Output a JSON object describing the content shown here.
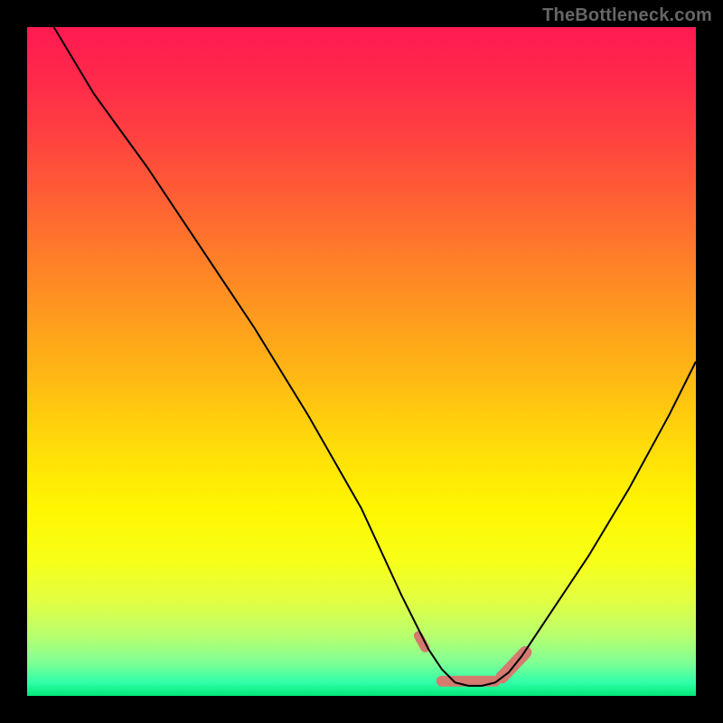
{
  "watermark": "TheBottleneck.com",
  "chart_data": {
    "type": "line",
    "title": "",
    "xlabel": "",
    "ylabel": "",
    "xlim": [
      0,
      100
    ],
    "ylim": [
      0,
      100
    ],
    "series": [
      {
        "name": "bottleneck-curve",
        "x": [
          4,
          10,
          18,
          26,
          34,
          42,
          50,
          56,
          60,
          62,
          64,
          66,
          68,
          70,
          72,
          74,
          78,
          84,
          90,
          96,
          100
        ],
        "y": [
          100,
          90,
          79,
          67,
          55,
          42,
          28,
          15,
          7,
          4,
          2,
          1.5,
          1.5,
          2,
          3.5,
          6,
          12,
          21,
          31,
          42,
          50
        ],
        "stroke": "#000000",
        "stroke_width": 2
      }
    ],
    "highlight": {
      "name": "optimal-band",
      "color": "#d47a6f",
      "segments": [
        {
          "x1": 58.5,
          "y1": 9.0,
          "x2": 59.5,
          "y2": 7.2,
          "w": 10
        },
        {
          "x1": 62.0,
          "y1": 2.2,
          "x2": 70.0,
          "y2": 2.2,
          "w": 12
        },
        {
          "x1": 71.0,
          "y1": 2.8,
          "x2": 74.5,
          "y2": 6.5,
          "w": 14
        }
      ]
    },
    "background_gradient": {
      "top_color": "#ff1a52",
      "mid_color": "#ffe008",
      "bottom_color": "#00e878"
    }
  }
}
